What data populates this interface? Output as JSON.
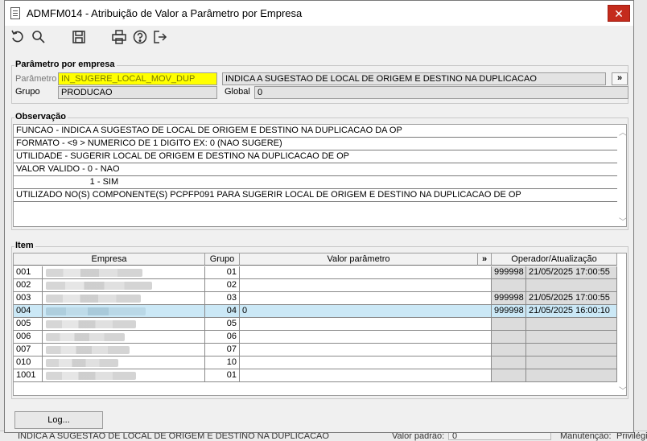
{
  "window": {
    "title": "ADMFM014 - Atribuição de Valor a Parâmetro por Empresa",
    "close_glyph": "✕"
  },
  "toolbar": {
    "buttons": [
      {
        "name": "undo-icon"
      },
      {
        "name": "search-icon"
      },
      {
        "name": "save-icon"
      },
      {
        "name": "print-icon"
      },
      {
        "name": "help-icon"
      },
      {
        "name": "exit-icon"
      }
    ]
  },
  "param": {
    "section_title": "Parâmetro por empresa",
    "parametro_label": "Parâmetro",
    "parametro_value": "IN_SUGERE_LOCAL_MOV_DUP",
    "description": "INDICA A SUGESTAO DE LOCAL DE ORIGEM E DESTINO NA DUPLICACAO",
    "expand_glyph": "»",
    "grupo_label": "Grupo",
    "grupo_value": "PRODUCAO",
    "global_label": "Global",
    "global_value": "0"
  },
  "observacao": {
    "section_title": "Observação",
    "lines": [
      "FUNCAO - INDICA A SUGESTAO DE LOCAL DE ORIGEM E DESTINO NA DUPLICACAO DA OP",
      "FORMATO - <9 > NUMERICO DE 1 DIGITO EX: 0 (NAO SUGERE)",
      "UTILIDADE - SUGERIR LOCAL DE ORIGEM E DESTINO NA DUPLICACAO DE OP",
      "VALOR VALIDO - 0 - NAO",
      "                              1 - SIM",
      "UTILIZADO NO(S) COMPONENTE(S) PCPFP091 PARA SUGERIR LOCAL DE ORIGEM E DESTINO NA DUPLICACAO DE OP"
    ]
  },
  "item": {
    "section_title": "Item",
    "columns": {
      "empresa": "Empresa",
      "grupo": "Grupo",
      "valor": "Valor parâmetro",
      "expand": "»",
      "operador": "Operador/Atualização"
    },
    "rows": [
      {
        "code": "001",
        "grupo": "01",
        "valor": "",
        "operador": "999998",
        "data": "21/05/2025 17:00:55",
        "selected": false
      },
      {
        "code": "002",
        "grupo": "02",
        "valor": "",
        "operador": "",
        "data": "",
        "selected": false
      },
      {
        "code": "003",
        "grupo": "03",
        "valor": "",
        "operador": "999998",
        "data": "21/05/2025 17:00:55",
        "selected": false
      },
      {
        "code": "004",
        "grupo": "04",
        "valor": "0",
        "operador": "999998",
        "data": "21/05/2025 16:00:10",
        "selected": true
      },
      {
        "code": "005",
        "grupo": "05",
        "valor": "",
        "operador": "",
        "data": "",
        "selected": false
      },
      {
        "code": "006",
        "grupo": "06",
        "valor": "",
        "operador": "",
        "data": "",
        "selected": false
      },
      {
        "code": "007",
        "grupo": "07",
        "valor": "",
        "operador": "",
        "data": "",
        "selected": false
      },
      {
        "code": "010",
        "grupo": "10",
        "valor": "",
        "operador": "",
        "data": "",
        "selected": false
      },
      {
        "code": "1001",
        "grupo": "01",
        "valor": "",
        "operador": "",
        "data": "",
        "selected": false
      }
    ]
  },
  "footer": {
    "log_button": "Log..."
  },
  "background": {
    "bottom_text": "INDICA A SUGESTAO DE LOCAL DE ORIGEM E DESTINO NA DUPLICACAO",
    "valor_padrao_label": "Valor padrão:",
    "valor_padrao_value": "0",
    "manutencao_label": "Manutenção:",
    "manutencao_value": "Privilégio"
  }
}
